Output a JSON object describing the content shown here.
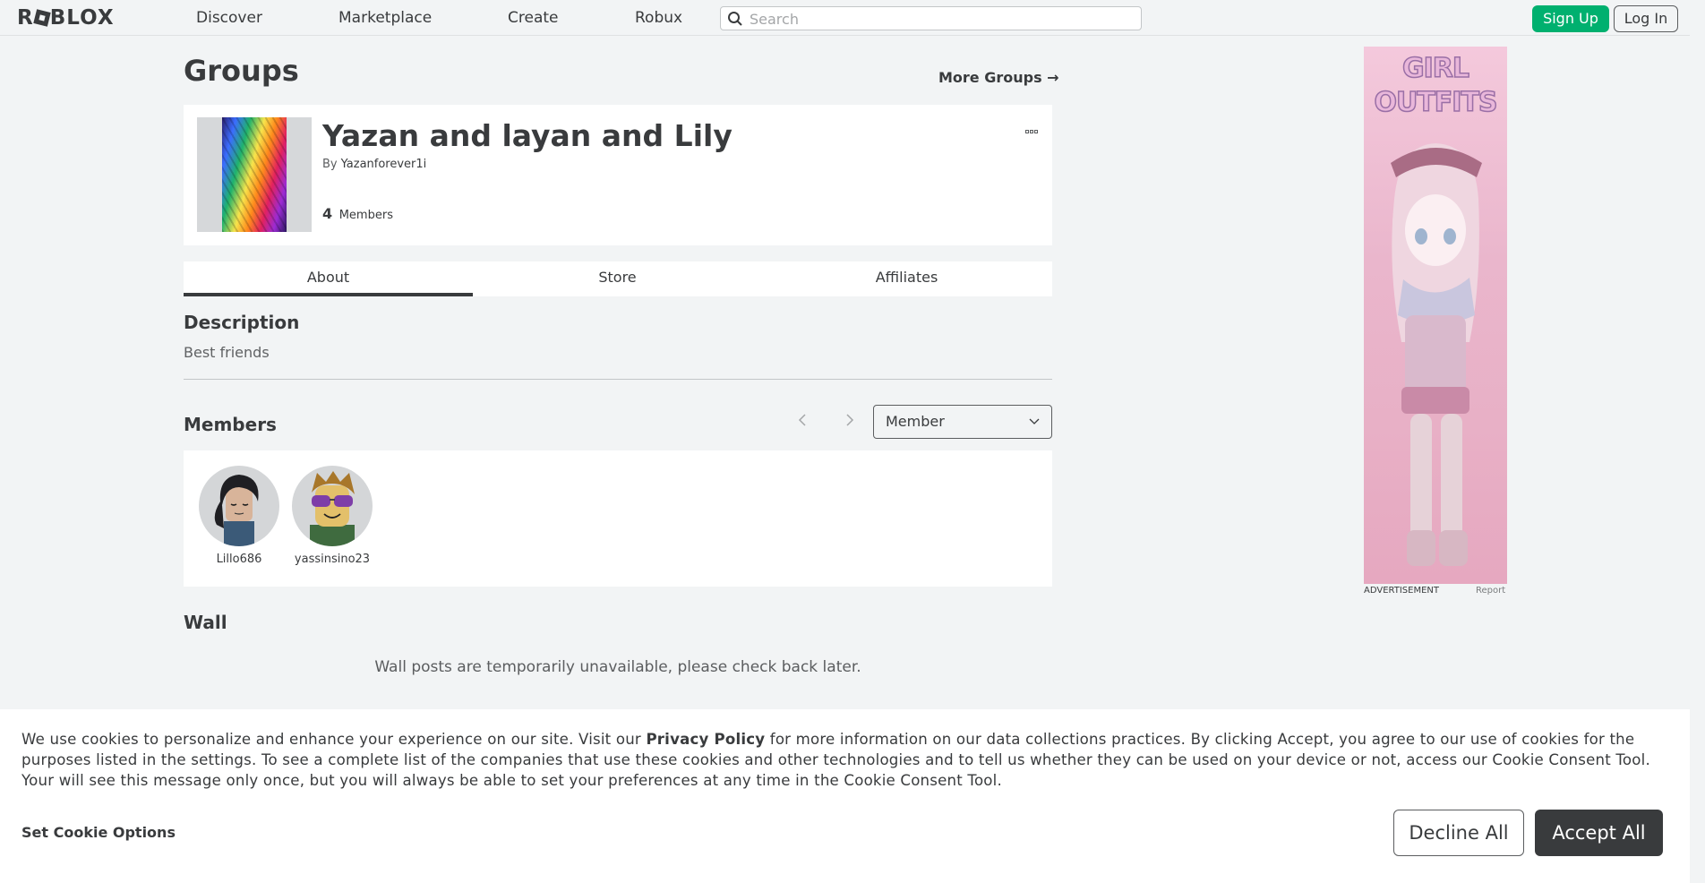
{
  "nav": {
    "logo": "ROBLOX",
    "links": [
      "Discover",
      "Marketplace",
      "Create",
      "Robux"
    ],
    "search_placeholder": "Search",
    "signup": "Sign Up",
    "login": "Log In"
  },
  "header": {
    "title": "Groups",
    "more_groups": "More Groups →"
  },
  "group": {
    "name": "Yazan and layan and Lily",
    "by_label": "By",
    "owner": "Yazanforever1i",
    "member_count": "4",
    "member_label": "Members"
  },
  "tabs": [
    {
      "label": "About",
      "active": true
    },
    {
      "label": "Store",
      "active": false
    },
    {
      "label": "Affiliates",
      "active": false
    }
  ],
  "description": {
    "title": "Description",
    "text": "Best friends"
  },
  "members": {
    "title": "Members",
    "role_filter": "Member",
    "list": [
      {
        "name": "Lillo686"
      },
      {
        "name": "yassinsino23"
      }
    ]
  },
  "wall": {
    "title": "Wall",
    "message": "Wall posts are temporarily unavailable, please check back later."
  },
  "ad": {
    "headline_1": "GIRL",
    "headline_2": "OUTFITS",
    "label": "ADVERTISEMENT",
    "report": "Report"
  },
  "cookie": {
    "text_before": "We use cookies to personalize and enhance your experience on our site. Visit our ",
    "policy_link": "Privacy Policy",
    "text_after": " for more information on our data collections practices. By clicking Accept, you agree to our use of cookies for the purposes listed in the settings. To see a complete list of the companies that use these cookies and other technologies and to tell us whether they can be used on your device or not, access our Cookie Consent Tool. Your will see this message only once, but you will always be able to set your preferences at any time in the Cookie Consent Tool.",
    "options": "Set Cookie Options",
    "decline": "Decline All",
    "accept": "Accept All"
  },
  "colors": {
    "background": "#f2f4f5",
    "card": "#ffffff",
    "signup_green": "#00b06f",
    "dark": "#393b3d"
  }
}
